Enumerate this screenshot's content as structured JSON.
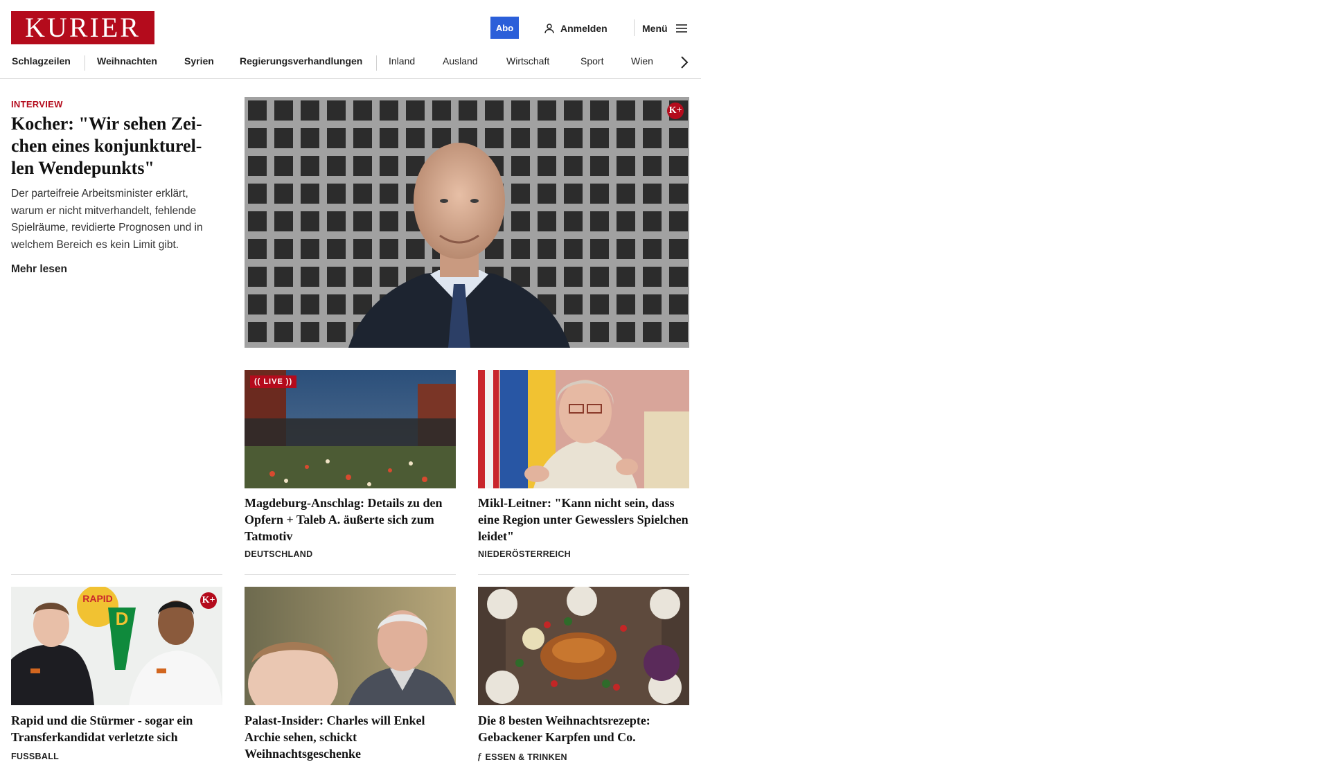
{
  "header": {
    "logo_text": "KURIER",
    "abo_label": "Abo",
    "login_label": "Anmelden",
    "menu_label": "Menü",
    "brand_color": "#b40b1c",
    "abo_color": "#2b5fd9"
  },
  "nav": {
    "items": [
      "Schlagzeilen",
      "Weihnachten",
      "Syrien",
      "Regierungsverhandlungen",
      "Inland",
      "Ausland",
      "Wirtschaft",
      "Sport",
      "Wien"
    ]
  },
  "lead": {
    "kicker": "INTERVIEW",
    "title": "Kocher: \"Wir sehen Zeichen eines konjunkturellen Wendepunkts\"",
    "title_lines": [
      "Kocher: \"Wir sehen Zei-",
      "chen eines konjunkturel-",
      "len Wendepunkts\""
    ],
    "teaser": "Der parteifreie Arbeitsminister erklärt, warum er nicht mitverhandelt, fehlende Spielräume, revidierte Prognosen und in welchem Bereich es kein Limit gibt.",
    "more_label": "Mehr lesen",
    "premium_badge": "K+"
  },
  "cards": [
    {
      "title": "Magdeburg-Anschlag: Details zu den Opfern + Taleb A. äußerte sich zum Tatmotiv",
      "category": "DEUTSCHLAND",
      "live_label": "LIVE"
    },
    {
      "title": "Mikl-Leitner: \"Kann nicht sein, dass eine Region unter Gewesslers Spielchen leidet\"",
      "category": "NIEDERÖSTERREICH"
    },
    {
      "title": "Rapid und die Stürmer - sogar ein Transferkandidat verletzte sich",
      "category": "FUSSBALL",
      "premium_badge": "K+"
    },
    {
      "title": "Palast-Insider: Charles will Enkel Archie sehen, schickt Weihnachtsgeschenke",
      "category": ""
    },
    {
      "title": "Die 8 besten Weihnachtsrezepte: Gebackener Karpfen und Co.",
      "category": "ESSEN & TRINKEN"
    }
  ]
}
